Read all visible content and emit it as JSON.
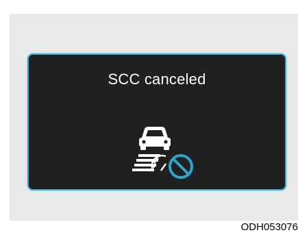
{
  "display": {
    "message": "SCC canceled",
    "icon": "scc-canceled-icon",
    "border_color": "#3aa8c9",
    "background_color": "#202020"
  },
  "image_code": "ODH053076"
}
